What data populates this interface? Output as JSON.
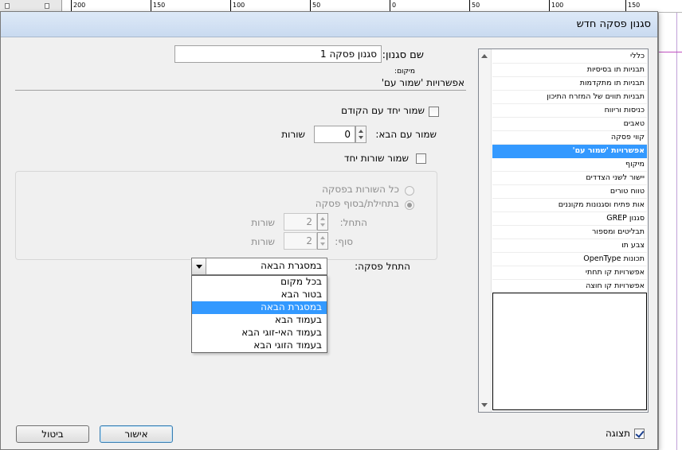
{
  "ruler": {
    "labels": [
      "200",
      "150",
      "100",
      "50",
      "0",
      "50",
      "100",
      "150"
    ]
  },
  "dialog": {
    "title": "סגנון פסקה חדש"
  },
  "sidebar": {
    "items": [
      {
        "label": "כללי"
      },
      {
        "label": "תבניות תו בסיסיות"
      },
      {
        "label": "תבניות תו מתקדמות"
      },
      {
        "label": "תבניות תווים של המזרח התיכון"
      },
      {
        "label": "כניסות וריווח"
      },
      {
        "label": "טאבים"
      },
      {
        "label": "קווי פסקה"
      },
      {
        "label": "אפשרויות 'שמור עם'",
        "selected": true
      },
      {
        "label": "מיקוף"
      },
      {
        "label": "יישור לשני הצדדים"
      },
      {
        "label": "טווח טורים"
      },
      {
        "label": "אות פתיח וסגנונות מקוננים"
      },
      {
        "label": "סגנון GREP"
      },
      {
        "label": "תבליטים ומספור"
      },
      {
        "label": "צבע תו"
      },
      {
        "label": "תכונות OpenType"
      },
      {
        "label": "אפשרויות קו תחתי"
      },
      {
        "label": "אפשרויות קו חוצה"
      }
    ]
  },
  "main": {
    "style_name_label": "שם סגנון:",
    "style_name_value": "סגנון פסקה 1",
    "location_label": "מיקום:",
    "section_title": "אפשרויות 'שמור עם'",
    "keep_with_previous_label": "שמור יחד עם הקודם",
    "keep_with_previous_checked": false,
    "keep_with_next_label": "שמור עם הבא:",
    "keep_with_next_value": "0",
    "lines_unit": "שורות",
    "keep_lines_together_label": "שמור שורות יחד",
    "keep_lines_together_checked": false,
    "all_lines_label": "כל השורות בפסקה",
    "start_end_label": "בתחילת/בסוף פסקה",
    "start_label": "התחל:",
    "start_value": "2",
    "end_label": "סוף:",
    "end_value": "2",
    "start_paragraph_label": "התחל פסקה:",
    "start_paragraph_value": "במסגרת הבאה",
    "start_paragraph_options": [
      {
        "label": "בכל מקום"
      },
      {
        "label": "בטור הבא"
      },
      {
        "label": "במסגרת הבאה",
        "selected": true
      },
      {
        "label": "בעמוד הבא"
      },
      {
        "label": "בעמוד האי-זוגי הבא"
      },
      {
        "label": "בעמוד הזוגי הבא"
      }
    ]
  },
  "footer": {
    "preview_label": "תצוגה",
    "preview_checked": true,
    "ok_label": "אישור",
    "cancel_label": "ביטול"
  }
}
